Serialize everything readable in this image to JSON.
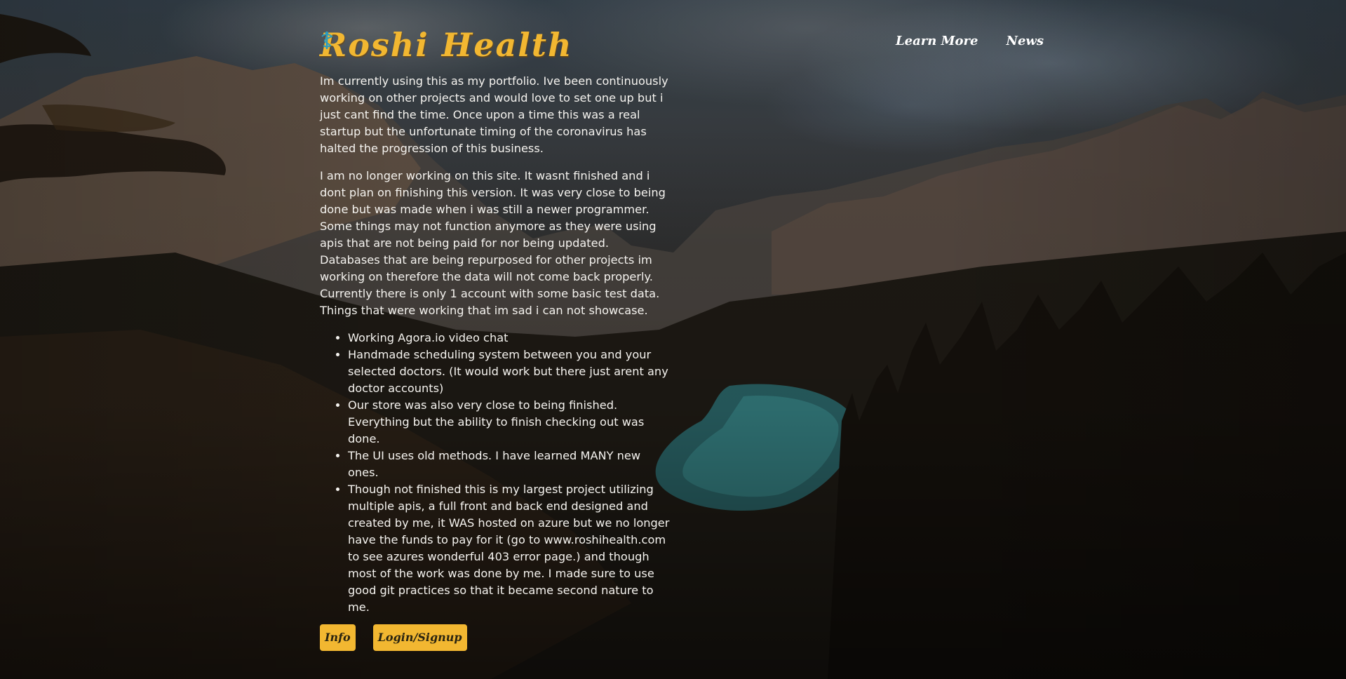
{
  "app": {
    "brand": "Roshi Health",
    "accent_color": "#f2b731"
  },
  "nav": {
    "items": [
      "Learn More",
      "News"
    ]
  },
  "main": {
    "paragraphs": [
      "Im currently using this as my portfolio. Ive been continuously working on other projects and would love to set one up but i just cant find the time. Once upon a time this was a real startup but the unfortunate timing of the coronavirus has halted the progression of this business.",
      "I am no longer working on this site. It wasnt finished and i dont plan on finishing this version. It was very close to being done but was made when i was still a newer programmer. Some things may not function anymore as they were using apis that are not being paid for nor being updated. Databases that are being repurposed for other projects im working on therefore the data will not come back properly. Currently there is only 1 account with some basic test data. Things that were working that im sad i can not showcase."
    ],
    "list": [
      "Working Agora.io video chat",
      "Handmade scheduling system between you and your selected doctors. (It would work but there just arent any doctor accounts)",
      "Our store was also very close to being finished. Everything but the ability to finish checking out was done.",
      "The UI uses old methods. I have learned MANY new ones.",
      "Though not finished this is my largest project utilizing multiple apis, a full front and back end designed and created by me, it WAS hosted on azure but we no longer have the funds to pay for it (go to www.roshihealth.com to see azures wonderful 403 error page.) and though most of the work was done by me. I made sure to use good git practices so that it became second nature to me."
    ],
    "buttons": {
      "info": "Info",
      "login": "Login/Signup"
    }
  }
}
